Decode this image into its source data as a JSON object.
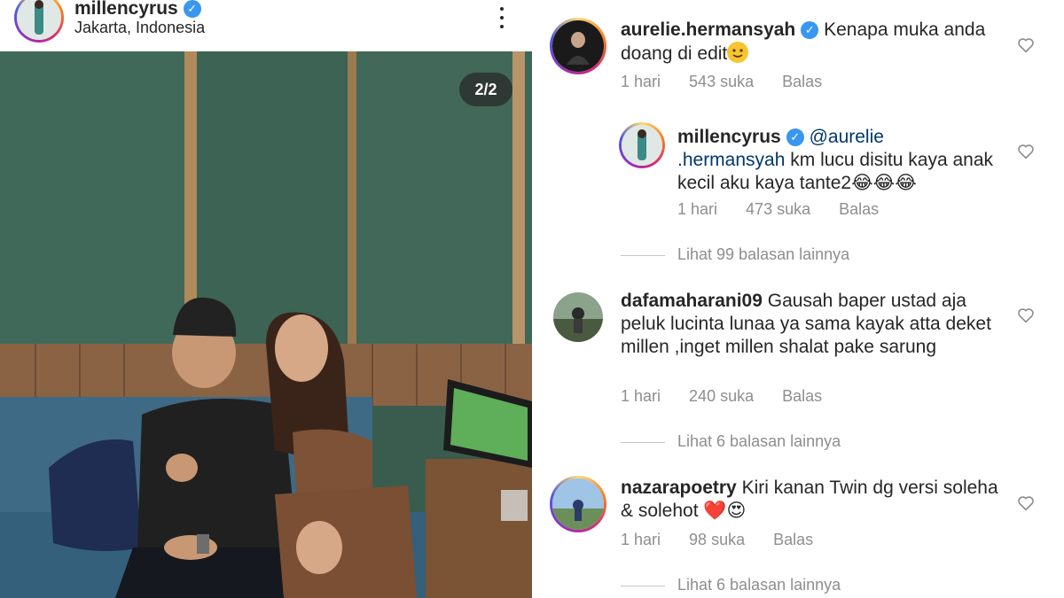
{
  "post": {
    "username": "millencyrus",
    "location": "Jakarta, Indonesia",
    "image_counter": "2/2"
  },
  "comments": [
    {
      "username": "aurelie.hermansyah",
      "verified": true,
      "text": "Kenapa muka anda doang di edit",
      "emoji": "🙂",
      "time": "1 hari",
      "likes": "543 suka",
      "reply": "Balas"
    },
    {
      "username": "millencyrus",
      "verified": true,
      "mention": "@aurelie .hermansyah",
      "text": "km lucu disitu kaya anak kecil aku kaya tante2",
      "emoji": "😂😂😂",
      "time": "1 hari",
      "likes": "473 suka",
      "reply": "Balas"
    },
    {
      "username": "dafamaharani09",
      "verified": false,
      "text": "Gausah baper ustad aja peluk lucinta lunaa ya sama kayak atta deket millen ,inget millen shalat pake sarung",
      "time": "1 hari",
      "likes": "240 suka",
      "reply": "Balas"
    },
    {
      "username": "nazarapoetry",
      "verified": false,
      "text": "Kiri kanan Twin dg versi soleha & solehot",
      "emoji": "❤️😍",
      "time": "1 hari",
      "likes": "98 suka",
      "reply": "Balas"
    }
  ],
  "view_replies": [
    "Lihat 99 balasan lainnya",
    "Lihat 6 balasan lainnya",
    "Lihat 6 balasan lainnya"
  ],
  "colors": {
    "verified": "#3897f0",
    "secondary_text": "#8e8e8e",
    "text": "#262626",
    "mention": "#00376b",
    "heart_red": "#ed1c24"
  },
  "icons": [
    "verified-badge-icon",
    "more-options-icon",
    "heart-outline-icon"
  ]
}
